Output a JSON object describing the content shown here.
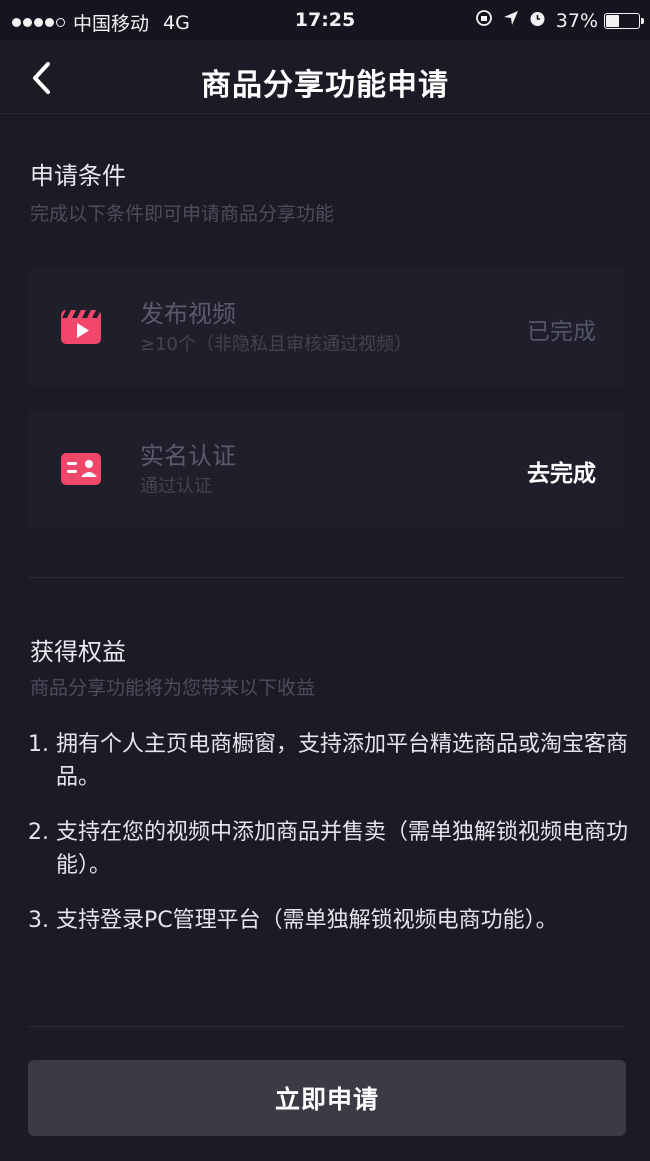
{
  "status_bar": {
    "carrier": "中国移动",
    "network": "4G",
    "time": "17:25",
    "battery": "37%",
    "battery_level": 0.37,
    "icons": [
      "lock-rotation-icon",
      "location-arrow-icon",
      "alarm-icon"
    ]
  },
  "nav": {
    "title": "商品分享功能申请",
    "back_icon": "chevron-left-icon"
  },
  "requirements": {
    "title": "申请条件",
    "subtitle": "完成以下条件即可申请商品分享功能",
    "items": [
      {
        "icon": "video-clapper-icon",
        "title": "发布视频",
        "subtitle": "≥10个（非隐私且审核通过视频）",
        "action": "已完成",
        "status": "done"
      },
      {
        "icon": "id-card-icon",
        "title": "实名认证",
        "subtitle": "通过认证",
        "action": "去完成",
        "status": "todo"
      }
    ]
  },
  "benefits": {
    "title": "获得权益",
    "subtitle": "商品分享功能将为您带来以下收益",
    "items": [
      {
        "num": "1.",
        "text": "拥有个人主页电商橱窗，支持添加平台精选商品或淘宝客商品。"
      },
      {
        "num": "2.",
        "text": "支持在您的视频中添加商品并售卖（需单独解锁视频电商功能）。"
      },
      {
        "num": "3.",
        "text": "支持登录PC管理平台（需单独解锁视频电商功能）。"
      }
    ]
  },
  "apply_button": {
    "label": "立即申请"
  },
  "colors": {
    "background": "#1b1b26",
    "card": "#1f1f2b",
    "accent_pink": "#f0476a",
    "button": "#3b3b46"
  }
}
